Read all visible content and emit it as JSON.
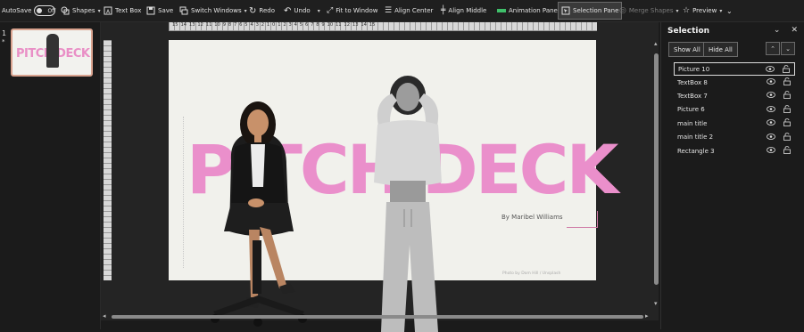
{
  "toolbar": {
    "autosave": "AutoSave",
    "autosave_state": "Off",
    "shapes": "Shapes",
    "text_box": "Text Box",
    "save": "Save",
    "switch_windows": "Switch Windows",
    "redo": "Redo",
    "undo": "Undo",
    "fit_to_window": "Fit to Window",
    "align_center": "Align Center",
    "align_middle": "Align Middle",
    "animation_pane": "Animation Pane",
    "selection_pane": "Selection Pane",
    "merge_shapes": "Merge Shapes",
    "preview": "Preview"
  },
  "thumbnails": {
    "slide_number": "1",
    "star": "*",
    "thumb_title": "PITCH DECK"
  },
  "slide": {
    "title": "PITCH DECK",
    "byline": "By Maribel Williams",
    "photo_credit": "Photo by Dom Hill / Unsplash"
  },
  "ruler": {
    "top_numbers": "15 14 13 12 11 10 9 8 7 6 5 4 3 2 1 0 1 2 3 4 5 6 7 8 9 10 11 12 13 14 15"
  },
  "selection_pane": {
    "title": "Selection",
    "show_all": "Show All",
    "hide_all": "Hide All",
    "items": [
      {
        "label": "Picture 10",
        "selected": true
      },
      {
        "label": "TextBox 8",
        "selected": false
      },
      {
        "label": "TextBox 7",
        "selected": false
      },
      {
        "label": "Picture 6",
        "selected": false
      },
      {
        "label": "main title",
        "selected": false
      },
      {
        "label": "main title 2",
        "selected": false
      },
      {
        "label": "Rectangle 3",
        "selected": false
      }
    ]
  },
  "colors": {
    "title_pink": "#ea8fcb",
    "slide_bg": "#f1f1ec",
    "animation_icon": "#3fbf6a"
  }
}
